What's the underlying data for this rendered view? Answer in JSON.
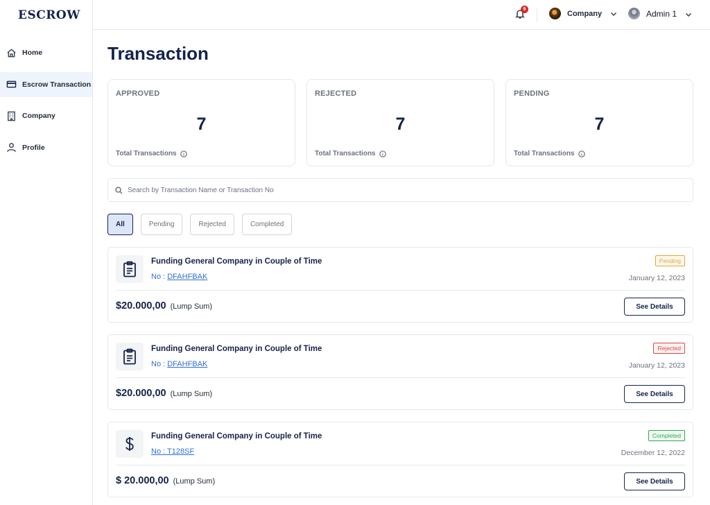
{
  "brand": "ESCROW",
  "sidebar": {
    "items": [
      {
        "label": "Home",
        "icon": "home-icon",
        "active": false
      },
      {
        "label": "Escrow Transaction",
        "icon": "card-icon",
        "active": true
      },
      {
        "label": "Company",
        "icon": "building-icon",
        "active": false
      },
      {
        "label": "Profile",
        "icon": "user-icon",
        "active": false
      }
    ]
  },
  "header": {
    "notification_count": "9",
    "company_label": "Company",
    "admin_label": "Admin 1"
  },
  "page": {
    "title": "Transaction"
  },
  "stats": [
    {
      "label": "APPROVED",
      "value": "7",
      "footer": "Total Transactions"
    },
    {
      "label": "REJECTED",
      "value": "7",
      "footer": "Total Transactions"
    },
    {
      "label": "PENDING",
      "value": "7",
      "footer": "Total Transactions"
    }
  ],
  "search": {
    "placeholder": "Search by Transaction Name or Transaction No"
  },
  "filters": [
    {
      "label": "All",
      "active": true
    },
    {
      "label": "Pending",
      "active": false
    },
    {
      "label": "Rejected",
      "active": false
    },
    {
      "label": "Completed",
      "active": false
    }
  ],
  "transactions": [
    {
      "icon": "clipboard-icon",
      "title": "Funding General Company in Couple of Time",
      "no_prefix": "No : ",
      "no": "DFAHFBAK",
      "status": "Pending",
      "date": "January 12, 2023",
      "amount": "$20.000,00",
      "type": "(Lump Sum)",
      "button": "See Details"
    },
    {
      "icon": "clipboard-icon",
      "title": "Funding General Company in Couple of Time",
      "no_prefix": "No : ",
      "no": "DFAHFBAK",
      "status": "Rejected",
      "date": "January 12, 2023",
      "amount": "$20.000,00",
      "type": "(Lump Sum)",
      "button": "See Details"
    },
    {
      "icon": "dollar-icon",
      "title": "Funding General Company in Couple of Time",
      "no_prefix": "No : ",
      "no": "T128SF",
      "status": "Completed",
      "date": "December 12, 2022",
      "amount": "$ 20.000,00",
      "type": "(Lump Sum)",
      "button": "See Details"
    }
  ],
  "colors": {
    "primary": "#14234b",
    "link": "#2f6fd6",
    "pending": "#e0a33a",
    "rejected": "#d94a4a",
    "completed": "#34a853"
  }
}
